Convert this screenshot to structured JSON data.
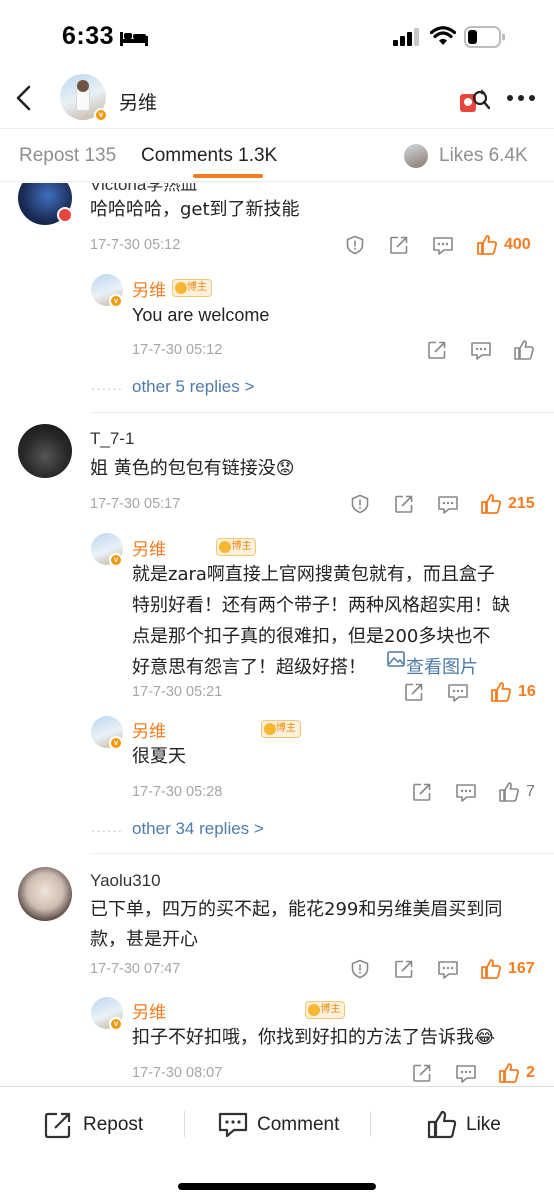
{
  "status": {
    "time": "6:33"
  },
  "header": {
    "name": "另维"
  },
  "tabs": {
    "repost": "Repost 135",
    "comments": "Comments 1.3K",
    "likes": "Likes 6.4K"
  },
  "comments": [
    {
      "name": "Victoria李热血",
      "text": "哈哈哈哈，get到了新技能",
      "time": "17-7-30 05:12",
      "likes": "400",
      "replies": [
        {
          "name": "另维",
          "badge": "博主",
          "text": "You are welcome",
          "time": "17-7-30 05:12"
        }
      ],
      "more": "other 5 replies >"
    },
    {
      "name": "T_7-1",
      "text": "姐 黄色的包包有链接没😟",
      "time": "17-7-30 05:17",
      "likes": "215",
      "replies": [
        {
          "name": "另维",
          "badge": "博主",
          "line1": "就是zara啊直接上官网搜黄包就有，而且盒子",
          "line2": "特别好看！还有两个带子！两种风格超实用！缺",
          "line3": "点是那个扣子真的很难扣，但是200多块也不",
          "line4": "好意思有怨言了！超级好搭！",
          "link": "查看图片",
          "time": "17-7-30 05:21",
          "likes": "16"
        },
        {
          "name": "另维",
          "badge": "博主",
          "text": "很夏天",
          "time": "17-7-30 05:28",
          "likes": "7"
        }
      ],
      "more": "other 34 replies >"
    },
    {
      "name": "Yaolu310",
      "line1": "已下单，四万的买不起，能花299和另维美眉买到同",
      "line2": "款，甚是开心",
      "time": "17-7-30 07:47",
      "likes": "167",
      "replies": [
        {
          "name": "另维",
          "badge": "博主",
          "text": "扣子不好扣哦，你找到好扣的方法了告诉我😂",
          "time": "17-7-30 08:07",
          "likes": "2"
        }
      ]
    }
  ],
  "bottom": {
    "repost": "Repost",
    "comment": "Comment",
    "like": "Like"
  },
  "colors": {
    "accent": "#f87c1f",
    "link": "#4f7bab"
  }
}
